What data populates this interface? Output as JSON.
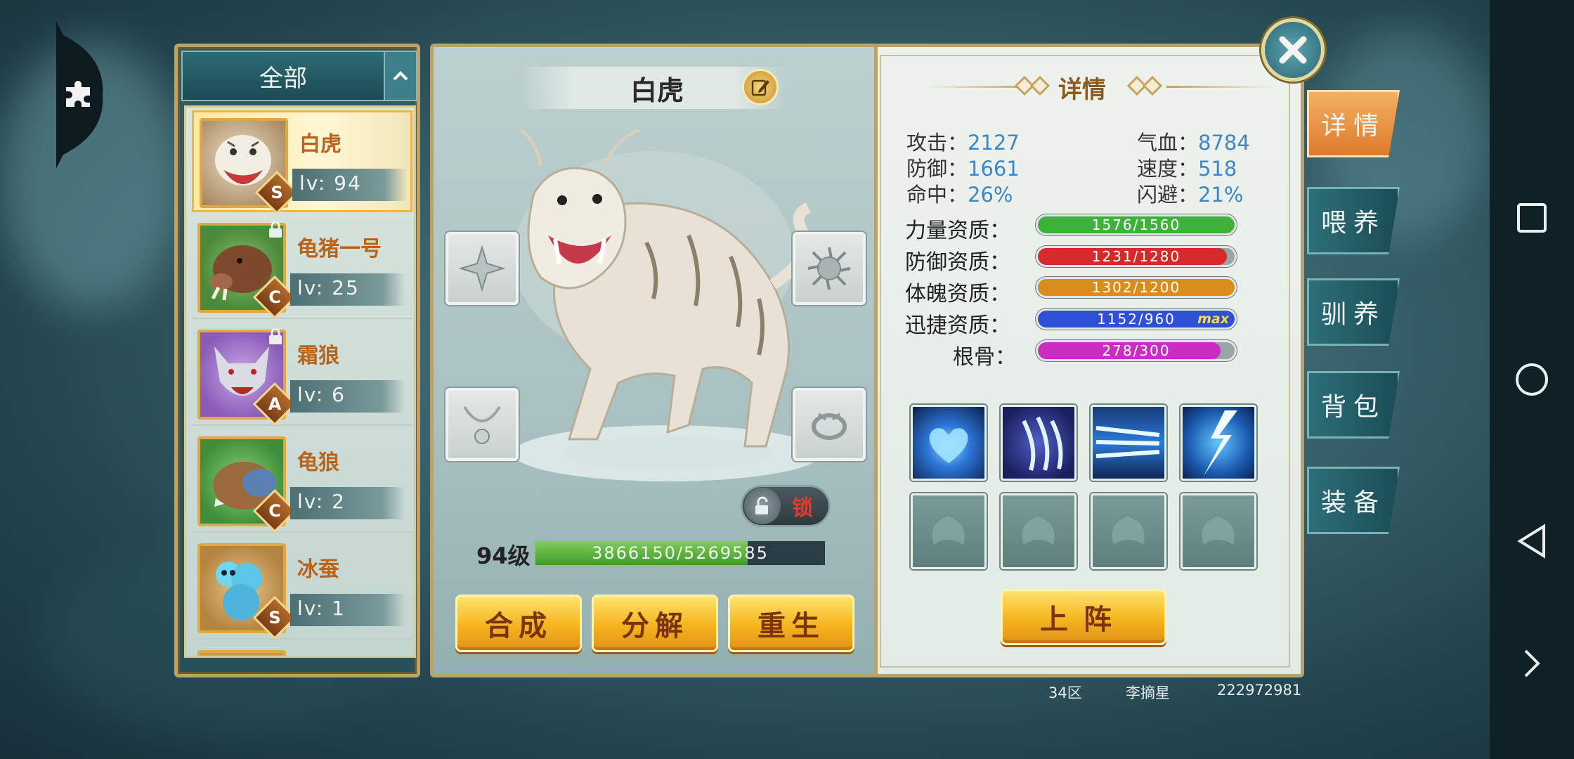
{
  "list": {
    "filter_label": "全部",
    "items": [
      {
        "name": "白虎",
        "level": "lv: 94",
        "grade": "S",
        "locked": false,
        "selected": true
      },
      {
        "name": "龟猪一号",
        "level": "lv: 25",
        "grade": "C",
        "locked": true,
        "selected": false
      },
      {
        "name": "霜狼",
        "level": "lv: 6",
        "grade": "A",
        "locked": true,
        "selected": false
      },
      {
        "name": "龟狼",
        "level": "lv: 2",
        "grade": "C",
        "locked": false,
        "selected": false
      },
      {
        "name": "冰蚕",
        "level": "lv: 1",
        "grade": "S",
        "locked": false,
        "selected": false
      }
    ]
  },
  "pet": {
    "name": "白虎",
    "lock_label": "锁",
    "level_label": "94级",
    "exp_text": "3866150/5269585",
    "exp_fraction": 0.734,
    "actions": {
      "compose": "合成",
      "decompose": "分解",
      "rebirth": "重生"
    }
  },
  "detail": {
    "title": "详情",
    "stats": {
      "attack_label": "攻击：",
      "attack": "2127",
      "hp_label": "气血：",
      "hp": "8784",
      "defense_label": "防御：",
      "defense": "1661",
      "speed_label": "速度：",
      "speed": "518",
      "hit_label": "命中：",
      "hit": "26%",
      "dodge_label": "闪避：",
      "dodge": "21%"
    },
    "aptitudes": [
      {
        "label": "力量资质：",
        "text": "1576/1560",
        "fill": 1.0,
        "color": "#3fb23b"
      },
      {
        "label": "防御资质：",
        "text": "1231/1280",
        "fill": 0.96,
        "color": "#d62a2a"
      },
      {
        "label": "体魄资质：",
        "text": "1302/1200",
        "fill": 1.0,
        "color": "#d98d1c"
      },
      {
        "label": "迅捷资质：",
        "text": "1152/960",
        "fill": 1.0,
        "color": "#2f4fd6",
        "max": "max"
      },
      {
        "label": "根骨：",
        "text": "278/300",
        "fill": 0.93,
        "color": "#c92ec1"
      }
    ],
    "deploy_label": "上阵"
  },
  "side_tabs": [
    "详情",
    "喂养",
    "驯养",
    "背包",
    "装备"
  ],
  "footer": {
    "server": "34区",
    "player": "李摘星",
    "id": "222972981"
  },
  "icons": {
    "close": "close-icon",
    "rename": "pencil-icon",
    "puzzle": "puzzle-icon"
  }
}
